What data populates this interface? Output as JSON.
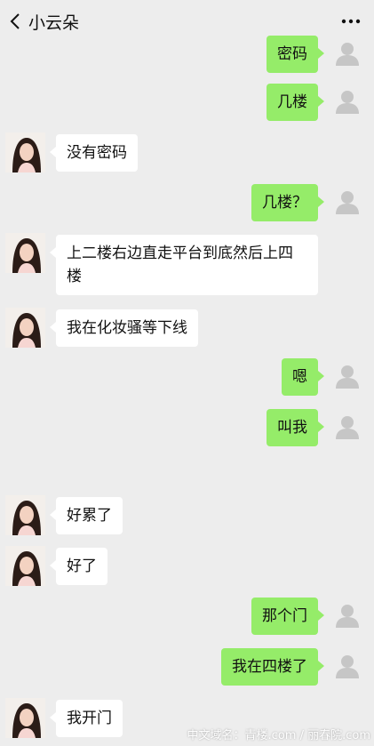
{
  "header": {
    "title": "小云朵",
    "back_icon": "chevron-left-icon",
    "more_icon": "ellipsis-icon"
  },
  "messages": [
    {
      "side": "self",
      "text": "密码"
    },
    {
      "side": "self",
      "text": "几楼"
    },
    {
      "side": "other",
      "text": "没有密码"
    },
    {
      "side": "self",
      "text": "几楼？"
    },
    {
      "side": "other",
      "text": "上二楼右边直走平台到底然后上四\n楼"
    },
    {
      "side": "other",
      "text": "我在化妆骚等下线"
    },
    {
      "side": "self",
      "text": "嗯"
    },
    {
      "side": "self",
      "text": "叫我"
    },
    {
      "side": "other",
      "text": "好累了"
    },
    {
      "side": "other",
      "text": "好了"
    },
    {
      "side": "self",
      "text": "那个门"
    },
    {
      "side": "self",
      "text": "我在四楼了"
    },
    {
      "side": "other",
      "text": "我开门"
    }
  ],
  "watermark": "中文域名：青楼.com / 丽春院.com",
  "colors": {
    "self_bubble": "#95ec69",
    "other_bubble": "#ffffff",
    "background": "#ededed"
  }
}
